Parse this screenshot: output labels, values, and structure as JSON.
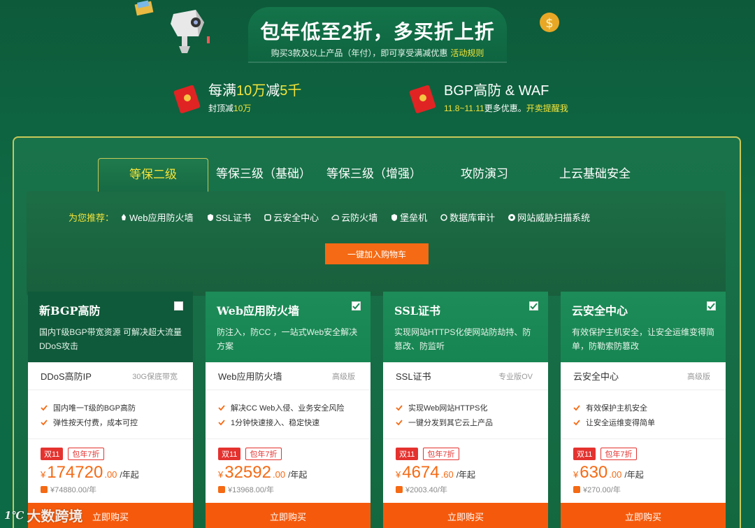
{
  "banner": {
    "headline": "包年低至2折，多买折上折",
    "subline": "购买3款及以上产品（年付），即可享受满减优惠",
    "rule_link": "活动规则"
  },
  "promos": [
    {
      "title_pre": "每满",
      "title_y1": "10万",
      "title_mid": "减",
      "title_y2": "5千",
      "sub_pre": "封顶减",
      "sub_y": "10万"
    },
    {
      "title": "BGP高防 & WAF",
      "sub_y1": "11.8~11.11",
      "sub_mid": "更多优惠。",
      "sub_y2": "开卖提醒我"
    }
  ],
  "tabs": [
    "等保二级",
    "等保三级（基础）",
    "等保三级（增强）",
    "攻防演习",
    "上云基础安全"
  ],
  "recommend": {
    "label": "为您推荐：",
    "items": [
      "Web应用防火墙",
      "SSL证书",
      "云安全中心",
      "云防火墙",
      "堡垒机",
      "数据库审计",
      "网站威胁扫描系统"
    ]
  },
  "cart_button": "一键加入购物车",
  "cards": [
    {
      "name": "新BGP高防",
      "desc": "国内T级BGP带宽资源 可解决超大流量DDoS攻击",
      "pname": "DDoS高防IP",
      "pver": "30G保底带宽",
      "feats": [
        "国内唯一T级的BGP高防",
        "弹性按天付费，成本可控"
      ],
      "badge1": "双11",
      "badge2": "包年7折",
      "cur": "¥",
      "price": "174720",
      "dec": ".00",
      "unit": "/年起",
      "orig": "¥74880.00/年",
      "buy": "立即购买",
      "color": "#0f5a3a"
    },
    {
      "name": "Web应用防火墙",
      "desc": "防注入，防CC ，一站式Web安全解决方案",
      "pname": "Web应用防火墙",
      "pver": "高级版",
      "feats": [
        "解决CC Web入侵、业务安全风险",
        "1分钟快速接入、稳定快速"
      ],
      "badge1": "双11",
      "badge2": "包年7折",
      "cur": "¥",
      "price": "32592",
      "dec": ".00",
      "unit": "/年起",
      "orig": "¥13968.00/年",
      "buy": "立即购买",
      "color": "#1a8a55"
    },
    {
      "name": "SSL证书",
      "desc": "实现网站HTTPS化使网站防劫持、防篡改、防监听",
      "pname": "SSL证书",
      "pver": "专业版OV",
      "feats": [
        "实现Web网站HTTPS化",
        "一键分发到其它云上产品"
      ],
      "badge1": "双11",
      "badge2": "包年7折",
      "cur": "¥",
      "price": "4674",
      "dec": ".60",
      "unit": "/年起",
      "orig": "¥2003.40/年",
      "buy": "立即购买",
      "color": "#1a8a55"
    },
    {
      "name": "云安全中心",
      "desc": "有效保护主机安全，让安全运维变得简单，防勒索防篡改",
      "pname": "云安全中心",
      "pver": "高级版",
      "feats": [
        "有效保护主机安全",
        "让安全运维变得简单"
      ],
      "badge1": "双11",
      "badge2": "包年7折",
      "cur": "¥",
      "price": "630",
      "dec": ".00",
      "unit": "/年起",
      "orig": "¥270.00/年",
      "buy": "立即购买",
      "color": "#1a8a55"
    }
  ],
  "watermark": {
    "logo": "1℃",
    "text": "大数跨境"
  }
}
